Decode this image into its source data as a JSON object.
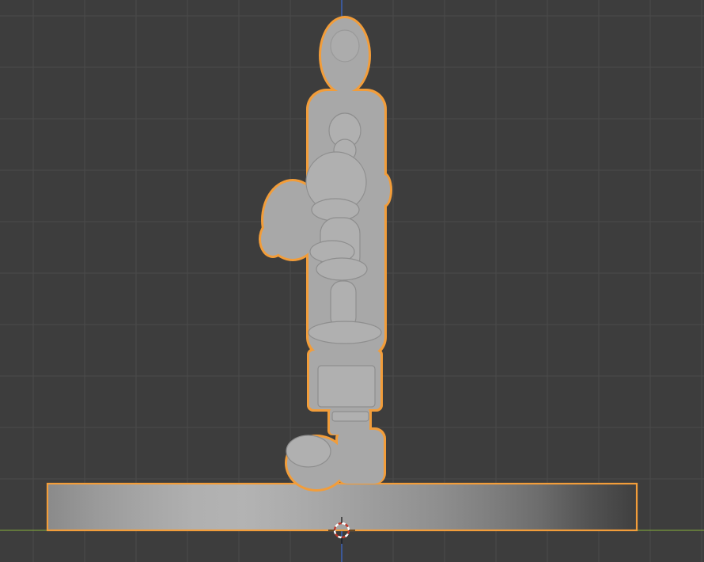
{
  "viewport": {
    "background": "#3d3d3d",
    "grid_minor_color": "#454545",
    "grid_major_color": "#4a4a4a",
    "x_axis_color": "#7a9a3c",
    "z_axis_color": "#3c6bd4"
  },
  "scene": {
    "object_fill": "#a8a8a8",
    "object_shade": "#8e8e8e",
    "selection_outline_color": "#f29d3a",
    "objects": [
      {
        "name": "figure",
        "selected": true
      },
      {
        "name": "base",
        "selected": true
      }
    ],
    "base_gradient": [
      "#8a8a8a",
      "#9a9a9a",
      "#a6a6a6",
      "#b0b0b0",
      "#b3b3b3",
      "#acacac",
      "#a3a3a3",
      "#999999",
      "#8e8e8e",
      "#7f7f7f",
      "#6d6d6d",
      "#535353",
      "#3f3f3f"
    ]
  },
  "cursor_3d": {
    "name": "3d-cursor",
    "colors": [
      "#c0392b",
      "#ffffff"
    ]
  }
}
